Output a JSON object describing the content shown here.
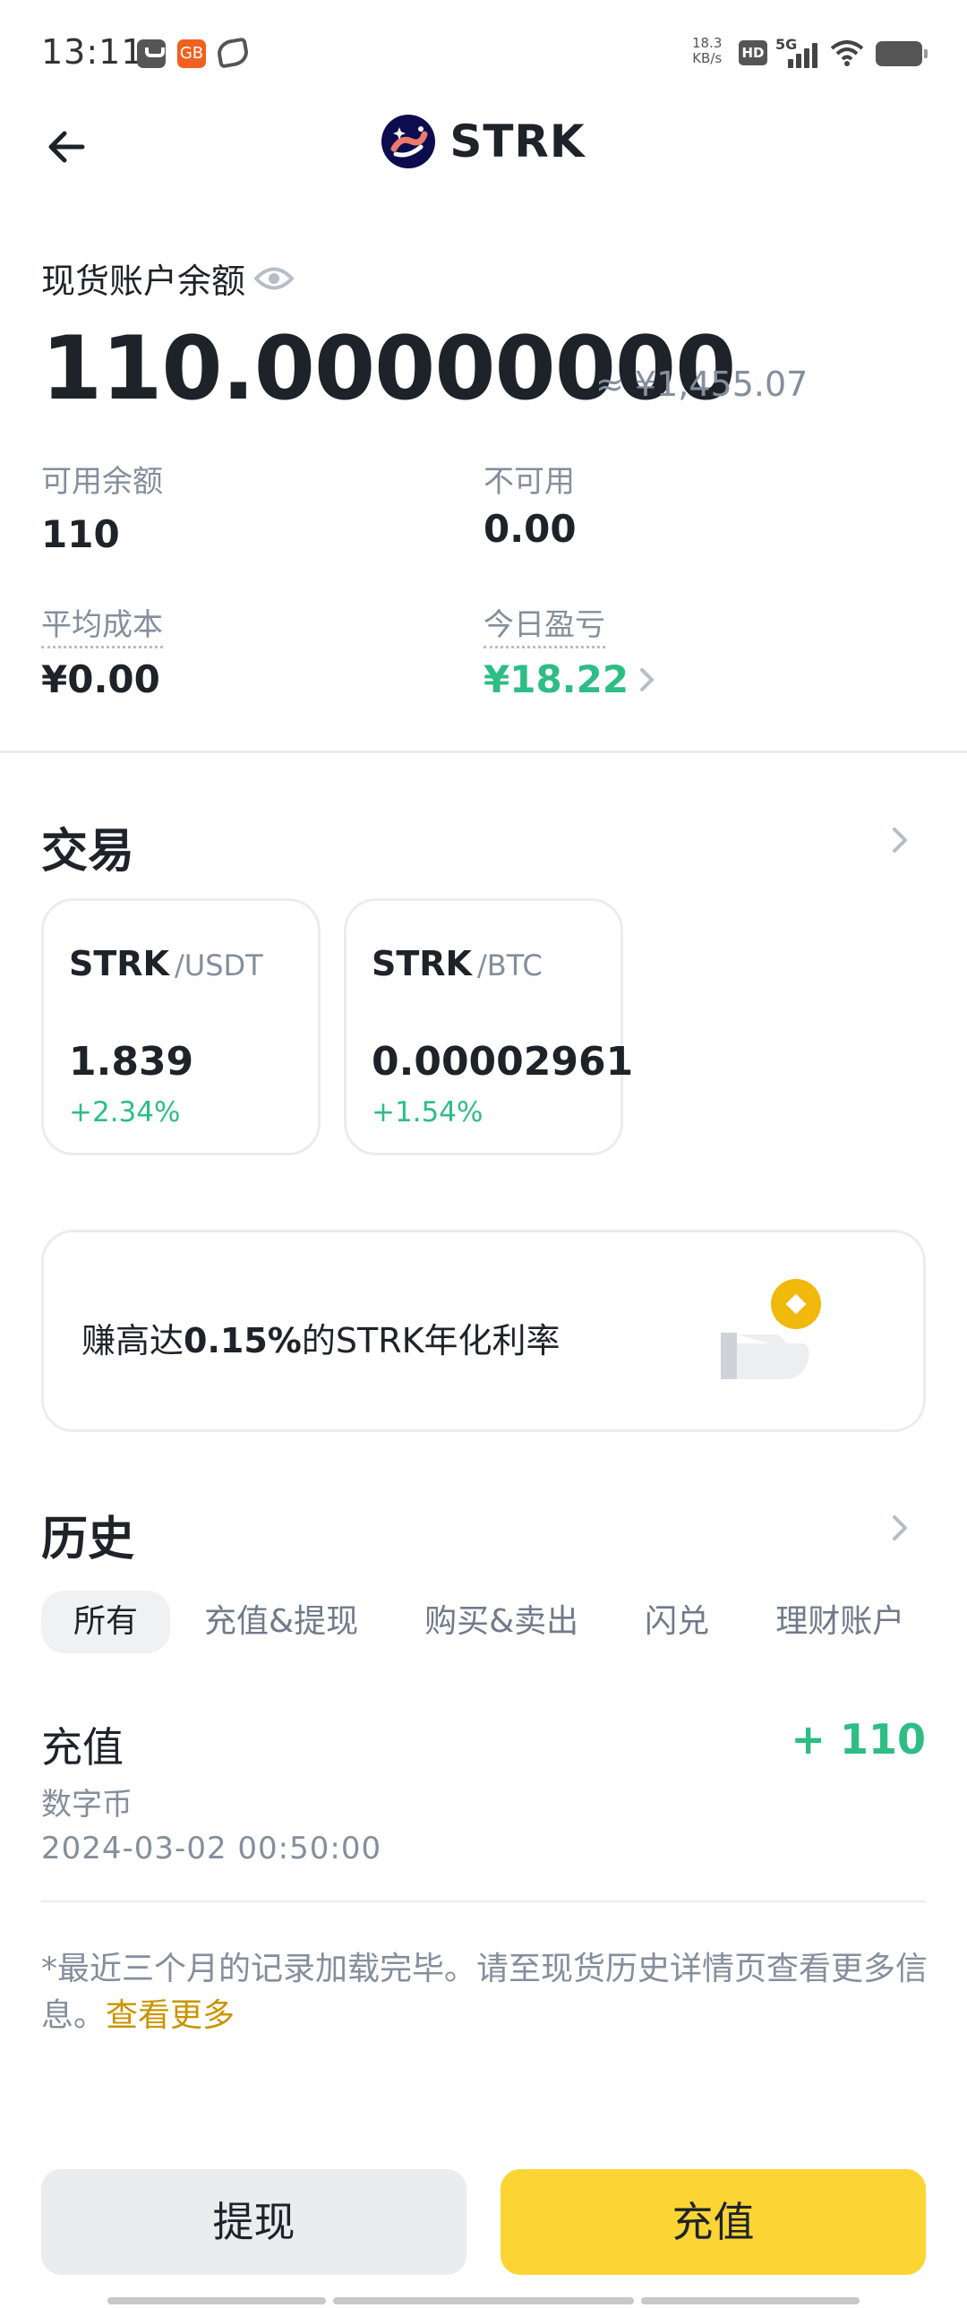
{
  "status_bar": {
    "time": "13:11",
    "app_icon_text": "GB",
    "speed_value": "18.3",
    "speed_unit": "KB/s",
    "hd": "HD",
    "network": "5G"
  },
  "header": {
    "coin": "STRK"
  },
  "balance": {
    "label": "现货账户余额",
    "amount": "110.00000000",
    "approx": "≈ ¥1,455.07",
    "available_label": "可用余额",
    "available_value": "110",
    "unavailable_label": "不可用",
    "unavailable_value": "0.00",
    "avg_cost_label": "平均成本",
    "avg_cost_value": "¥0.00",
    "today_pnl_label": "今日盈亏",
    "today_pnl_value": "¥18.22"
  },
  "trade": {
    "title": "交易",
    "pairs": [
      {
        "base": "STRK",
        "quote": "/USDT",
        "price": "1.839",
        "change": "+2.34%"
      },
      {
        "base": "STRK",
        "quote": "/BTC",
        "price": "0.00002961",
        "change": "+1.54%"
      }
    ]
  },
  "earn": {
    "prefix": "赚高达",
    "rate": "0.15%",
    "suffix": "的STRK年化利率"
  },
  "history": {
    "title": "历史",
    "tabs": [
      "所有",
      "充值&提现",
      "购买&卖出",
      "闪兑",
      "理财账户"
    ],
    "records": [
      {
        "type": "充值",
        "amount": "+ 110",
        "asset": "数字币",
        "time": "2024-03-02 00:50:00"
      }
    ],
    "footnote": "*最近三个月的记录加载完毕。请至现货历史详情页查看更多信息。",
    "see_more": "查看更多"
  },
  "actions": {
    "withdraw": "提现",
    "deposit": "充值"
  },
  "colors": {
    "brand_yellow": "#fcd535",
    "positive_green": "#2ebd85",
    "link_gold": "#c99400"
  }
}
